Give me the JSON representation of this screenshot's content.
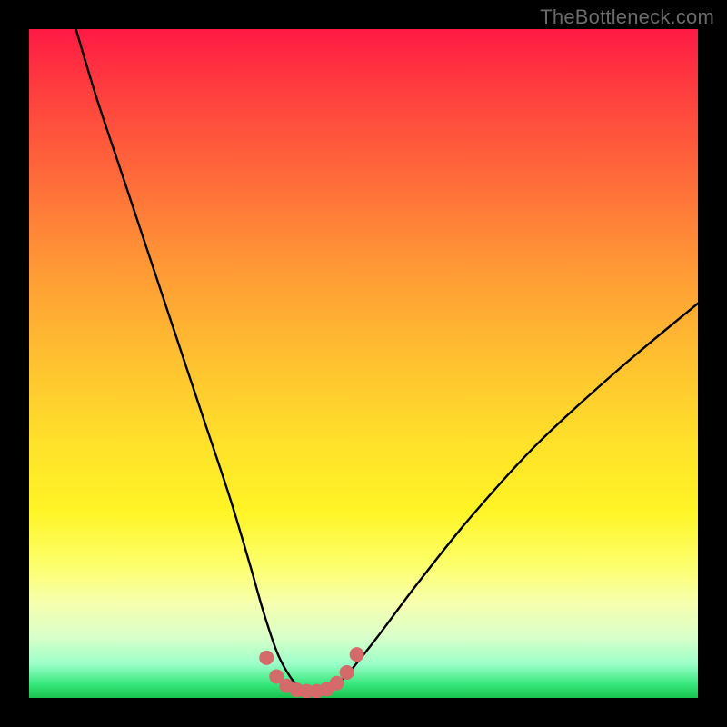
{
  "watermark": "TheBottleneck.com",
  "colors": {
    "background": "#000000",
    "curve_stroke": "#000000",
    "marker_fill": "#d46a6a",
    "gradient_top": "#ff1a44",
    "gradient_bottom": "#18c24e"
  },
  "chart_data": {
    "type": "line",
    "title": "",
    "xlabel": "",
    "ylabel": "",
    "xlim": [
      0,
      100
    ],
    "ylim": [
      0,
      100
    ],
    "series": [
      {
        "name": "bottleneck-curve",
        "x": [
          7,
          10,
          14,
          18,
          22,
          26,
          30,
          33,
          35,
          37,
          38.5,
          40,
          42,
          44,
          46,
          48,
          52,
          58,
          66,
          76,
          88,
          100
        ],
        "y": [
          100,
          90,
          78,
          66,
          54,
          42,
          30,
          20,
          13,
          7,
          4,
          2,
          1,
          1,
          2,
          4,
          9,
          17,
          27,
          38,
          49,
          59
        ]
      }
    ],
    "markers": {
      "name": "valley-dots",
      "x": [
        35.5,
        37,
        38.5,
        40,
        41.5,
        43,
        44.5,
        46,
        47.5,
        49
      ],
      "y": [
        6,
        3.2,
        1.8,
        1.2,
        1,
        1,
        1.3,
        2.2,
        3.8,
        6.5
      ]
    }
  }
}
